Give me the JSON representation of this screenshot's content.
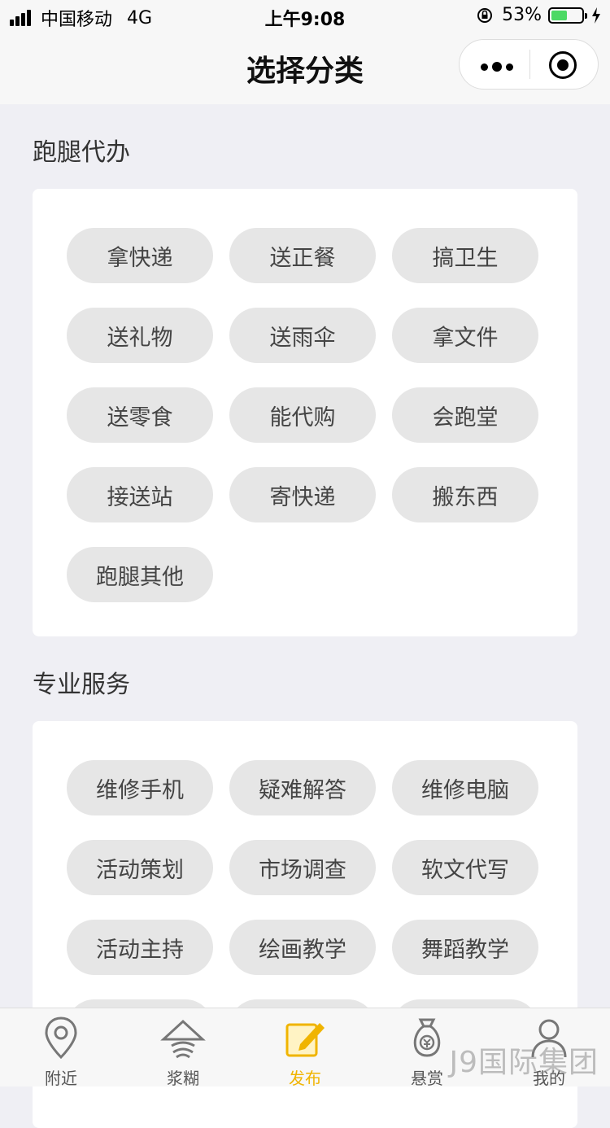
{
  "status": {
    "carrier": "中国移动",
    "network": "4G",
    "time": "上午9:08",
    "battery": "53%",
    "battery_level": 0.53
  },
  "nav": {
    "title": "选择分类"
  },
  "sections": [
    {
      "title": "跑腿代办",
      "tags": [
        "拿快递",
        "送正餐",
        "搞卫生",
        "送礼物",
        "送雨伞",
        "拿文件",
        "送零食",
        "能代购",
        "会跑堂",
        "接送站",
        "寄快递",
        "搬东西",
        "跑腿其他"
      ]
    },
    {
      "title": "专业服务",
      "tags": [
        "维修手机",
        "疑难解答",
        "维修电脑",
        "活动策划",
        "市场调查",
        "软文代写",
        "活动主持",
        "绘画教学",
        "舞蹈教学",
        "",
        "",
        ""
      ]
    }
  ],
  "tabbar": [
    {
      "label": "附近",
      "icon": "location-pin-icon"
    },
    {
      "label": "浆糊",
      "icon": "straw-hat-icon"
    },
    {
      "label": "发布",
      "icon": "edit-icon"
    },
    {
      "label": "悬赏",
      "icon": "money-bag-icon"
    },
    {
      "label": "我的",
      "icon": "user-icon"
    }
  ],
  "watermark": "J9国际集团",
  "colors": {
    "accent": "#f0b400",
    "tag_bg": "#e6e6e6",
    "background": "#efeff4"
  }
}
